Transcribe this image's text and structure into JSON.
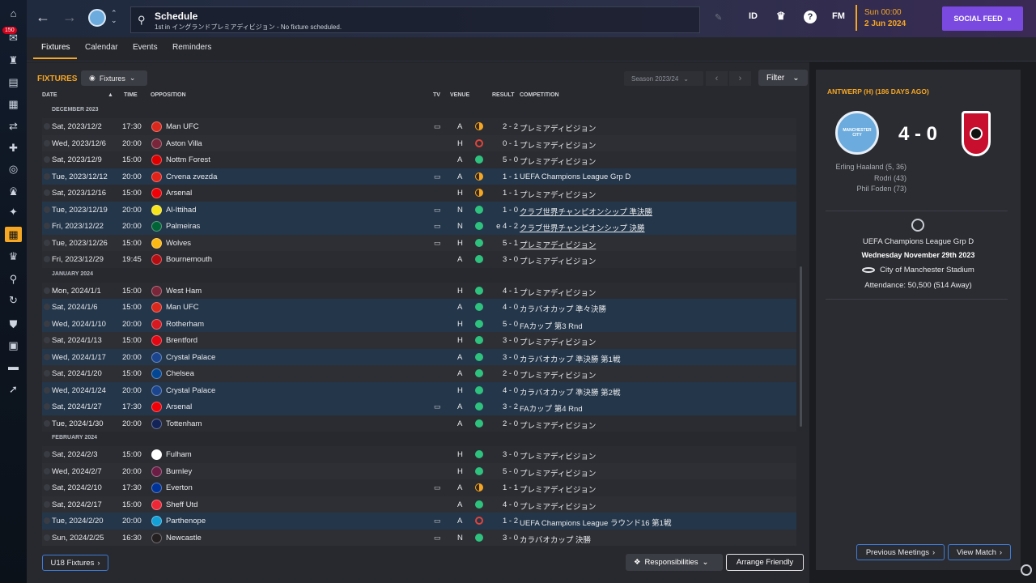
{
  "rail": {
    "badge": "150",
    "icons": [
      "home-icon",
      "inbox-icon",
      "squad-icon",
      "tactics-icon",
      "data-icon",
      "transfers-icon",
      "medical-icon",
      "scouting-icon",
      "staff-icon",
      "training-icon",
      "club-vision-icon",
      "schedule-icon",
      "competitions-icon",
      "search-icon",
      "transfer-hub-icon",
      "club-info-icon",
      "finances-icon",
      "dev-centre-icon",
      "career-icon"
    ]
  },
  "topbar": {
    "search_title": "Schedule",
    "search_subtitle": "1st in イングランドプレミアディビジョン - No fixture scheduled.",
    "id_label": "ID",
    "fm_label": "FM",
    "help_label": "?",
    "date_line1": "Sun 00:00",
    "date_line2": "2 Jun 2024",
    "social_feed": "SOCIAL FEED"
  },
  "tabs": [
    "Fixtures",
    "Calendar",
    "Events",
    "Reminders"
  ],
  "fixtures": {
    "title": "FIXTURES",
    "view_dropdown": "Fixtures",
    "season": "Season 2023/24",
    "filter": "Filter",
    "columns": {
      "date": "DATE",
      "time": "TIME",
      "opposition": "OPPOSITION",
      "tv": "TV",
      "venue": "VENUE",
      "result": "RESULT",
      "competition": "COMPETITION"
    },
    "months": [
      {
        "label": "DECEMBER 2023",
        "rows": [
          {
            "date": "Sat, 2023/12/2",
            "time": "17:30",
            "opp": "Man UFC",
            "crest": "#da291c",
            "tv": true,
            "venue": "A",
            "res": "d",
            "score": "2 - 2",
            "comp": "プレミアディビジョン",
            "alt": false,
            "u": false
          },
          {
            "date": "Wed, 2023/12/6",
            "time": "20:00",
            "opp": "Aston Villa",
            "crest": "#7a263a",
            "tv": false,
            "venue": "H",
            "res": "l",
            "score": "0 - 1",
            "comp": "プレミアディビジョン",
            "alt": false,
            "u": false
          },
          {
            "date": "Sat, 2023/12/9",
            "time": "15:00",
            "opp": "Nottm Forest",
            "crest": "#dd0000",
            "tv": false,
            "venue": "A",
            "res": "w",
            "score": "5 - 0",
            "comp": "プレミアディビジョン",
            "alt": false,
            "u": false
          },
          {
            "date": "Tue, 2023/12/12",
            "time": "20:00",
            "opp": "Crvena zvezda",
            "crest": "#e2231a",
            "tv": true,
            "venue": "A",
            "res": "d",
            "score": "1 - 1",
            "comp": "UEFA Champions League Grp D",
            "alt": true,
            "u": false
          },
          {
            "date": "Sat, 2023/12/16",
            "time": "15:00",
            "opp": "Arsenal",
            "crest": "#ef0107",
            "tv": false,
            "venue": "H",
            "res": "d",
            "score": "1 - 1",
            "comp": "プレミアディビジョン",
            "alt": false,
            "u": false
          },
          {
            "date": "Tue, 2023/12/19",
            "time": "20:00",
            "opp": "Al-Ittihad",
            "crest": "#f7e31b",
            "tv": true,
            "venue": "N",
            "res": "w",
            "score": "1 - 0",
            "comp": "クラブ世界チャンピオンシップ 準決勝",
            "alt": true,
            "u": true
          },
          {
            "date": "Fri, 2023/12/22",
            "time": "20:00",
            "opp": "Palmeiras",
            "crest": "#006437",
            "tv": true,
            "venue": "N",
            "res": "w",
            "score": "e 4 - 2",
            "comp": "クラブ世界チャンピオンシップ 決勝",
            "alt": true,
            "u": true
          },
          {
            "date": "Tue, 2023/12/26",
            "time": "15:00",
            "opp": "Wolves",
            "crest": "#fdb913",
            "tv": true,
            "venue": "H",
            "res": "w",
            "score": "5 - 1",
            "comp": "プレミアディビジョン",
            "alt": false,
            "u": true
          },
          {
            "date": "Fri, 2023/12/29",
            "time": "19:45",
            "opp": "Bournemouth",
            "crest": "#b50e12",
            "tv": false,
            "venue": "A",
            "res": "w",
            "score": "3 - 0",
            "comp": "プレミアディビジョン",
            "alt": false,
            "u": false
          }
        ]
      },
      {
        "label": "JANUARY 2024",
        "rows": [
          {
            "date": "Mon, 2024/1/1",
            "time": "15:00",
            "opp": "West Ham",
            "crest": "#7a263a",
            "tv": false,
            "venue": "H",
            "res": "w",
            "score": "4 - 1",
            "comp": "プレミアディビジョン",
            "alt": false,
            "u": false
          },
          {
            "date": "Sat, 2024/1/6",
            "time": "15:00",
            "opp": "Man UFC",
            "crest": "#da291c",
            "tv": false,
            "venue": "A",
            "res": "w",
            "score": "4 - 0",
            "comp": "カラバオカップ 準々決勝",
            "alt": true,
            "u": false
          },
          {
            "date": "Wed, 2024/1/10",
            "time": "20:00",
            "opp": "Rotherham",
            "crest": "#d71921",
            "tv": false,
            "venue": "H",
            "res": "w",
            "score": "5 - 0",
            "comp": "FAカップ 第3 Rnd",
            "alt": true,
            "u": false
          },
          {
            "date": "Sat, 2024/1/13",
            "time": "15:00",
            "opp": "Brentford",
            "crest": "#e30613",
            "tv": false,
            "venue": "H",
            "res": "w",
            "score": "3 - 0",
            "comp": "プレミアディビジョン",
            "alt": false,
            "u": false
          },
          {
            "date": "Wed, 2024/1/17",
            "time": "20:00",
            "opp": "Crystal Palace",
            "crest": "#1b458f",
            "tv": false,
            "venue": "A",
            "res": "w",
            "score": "3 - 0",
            "comp": "カラバオカップ 準決勝 第1戦",
            "alt": true,
            "u": false
          },
          {
            "date": "Sat, 2024/1/20",
            "time": "15:00",
            "opp": "Chelsea",
            "crest": "#034694",
            "tv": false,
            "venue": "A",
            "res": "w",
            "score": "2 - 0",
            "comp": "プレミアディビジョン",
            "alt": false,
            "u": false
          },
          {
            "date": "Wed, 2024/1/24",
            "time": "20:00",
            "opp": "Crystal Palace",
            "crest": "#1b458f",
            "tv": false,
            "venue": "H",
            "res": "w",
            "score": "4 - 0",
            "comp": "カラバオカップ 準決勝 第2戦",
            "alt": true,
            "u": false
          },
          {
            "date": "Sat, 2024/1/27",
            "time": "17:30",
            "opp": "Arsenal",
            "crest": "#ef0107",
            "tv": true,
            "venue": "A",
            "res": "w",
            "score": "3 - 2",
            "comp": "FAカップ 第4 Rnd",
            "alt": true,
            "u": false
          },
          {
            "date": "Tue, 2024/1/30",
            "time": "20:00",
            "opp": "Tottenham",
            "crest": "#132257",
            "tv": false,
            "venue": "A",
            "res": "w",
            "score": "2 - 0",
            "comp": "プレミアディビジョン",
            "alt": false,
            "u": false
          }
        ]
      },
      {
        "label": "FEBRUARY 2024",
        "rows": [
          {
            "date": "Sat, 2024/2/3",
            "time": "15:00",
            "opp": "Fulham",
            "crest": "#ffffff",
            "tv": false,
            "venue": "H",
            "res": "w",
            "score": "3 - 0",
            "comp": "プレミアディビジョン",
            "alt": false,
            "u": false
          },
          {
            "date": "Wed, 2024/2/7",
            "time": "20:00",
            "opp": "Burnley",
            "crest": "#6c1d45",
            "tv": false,
            "venue": "H",
            "res": "w",
            "score": "5 - 0",
            "comp": "プレミアディビジョン",
            "alt": false,
            "u": false
          },
          {
            "date": "Sat, 2024/2/10",
            "time": "17:30",
            "opp": "Everton",
            "crest": "#003399",
            "tv": true,
            "venue": "A",
            "res": "d",
            "score": "1 - 1",
            "comp": "プレミアディビジョン",
            "alt": false,
            "u": false
          },
          {
            "date": "Sat, 2024/2/17",
            "time": "15:00",
            "opp": "Sheff Utd",
            "crest": "#ee2737",
            "tv": false,
            "venue": "A",
            "res": "w",
            "score": "4 - 0",
            "comp": "プレミアディビジョン",
            "alt": false,
            "u": false
          },
          {
            "date": "Tue, 2024/2/20",
            "time": "20:00",
            "opp": "Parthenope",
            "crest": "#12a0d7",
            "tv": true,
            "venue": "A",
            "res": "l",
            "score": "1 - 2",
            "comp": "UEFA Champions League ラウンド16 第1戦",
            "alt": true,
            "u": false
          },
          {
            "date": "Sun, 2024/2/25",
            "time": "16:30",
            "opp": "Newcastle",
            "crest": "#241f20",
            "tv": true,
            "venue": "N",
            "res": "w",
            "score": "3 - 0",
            "comp": "カラバオカップ 決勝",
            "alt": false,
            "u": false
          }
        ]
      }
    ],
    "u18_button": "U18 Fixtures",
    "responsibilities": "Responsibilities",
    "arrange_friendly": "Arrange Friendly"
  },
  "match_panel": {
    "title": "ANTWERP (H) (186 DAYS AGO)",
    "home_crest_text": "MANCHESTER CITY",
    "score": "4 - 0",
    "scorers": [
      "Erling Haaland (5, 36)",
      "Rodri (43)",
      "Phil Foden (73)"
    ],
    "competition": "UEFA Champions League Grp D",
    "date": "Wednesday November 29th 2023",
    "stadium": "City of Manchester Stadium",
    "attendance": "Attendance: 50,500 (514 Away)",
    "previous_meetings": "Previous Meetings",
    "view_match": "View Match"
  },
  "colors": {
    "accent": "#f5a623",
    "win": "#2ec27e",
    "loss": "#e0443a",
    "social": "#7a4ae0",
    "highlight_row": "#24364a"
  }
}
